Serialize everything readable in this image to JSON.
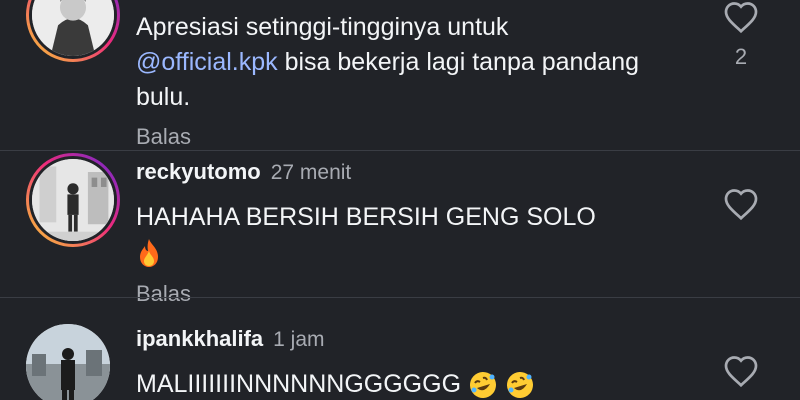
{
  "comments": [
    {
      "username": "",
      "time": "",
      "text_before": "Apresiasi setinggi-tingginya untuk",
      "mention": "@official.kpk",
      "text_after": " bisa bekerja lagi tanpa pandang bulu.",
      "reply_label": "Balas",
      "likes": "2",
      "avatar": "profile-photo",
      "has_story_ring": true
    },
    {
      "username": "reckyutomo",
      "time": "27 menit",
      "text": "HAHAHA BERSIH BERSIH GENG SOLO",
      "emoji": "fire-emoji",
      "reply_label": "Balas",
      "likes": "",
      "avatar": "profile-photo",
      "has_story_ring": true
    },
    {
      "username": "ipankkhalifa",
      "time": "1 jam",
      "text": "MALIIIIIIINNNNNNGGGGGG",
      "emoji": "rolling-laughing-emoji",
      "likes": "",
      "avatar": "profile-photo",
      "has_story_ring": false
    }
  ],
  "colors": {
    "background": "#212328",
    "text": "#f3f5f7",
    "secondary": "#a8abb2",
    "mention": "#9bb8ff",
    "divider": "#3a3d44"
  }
}
